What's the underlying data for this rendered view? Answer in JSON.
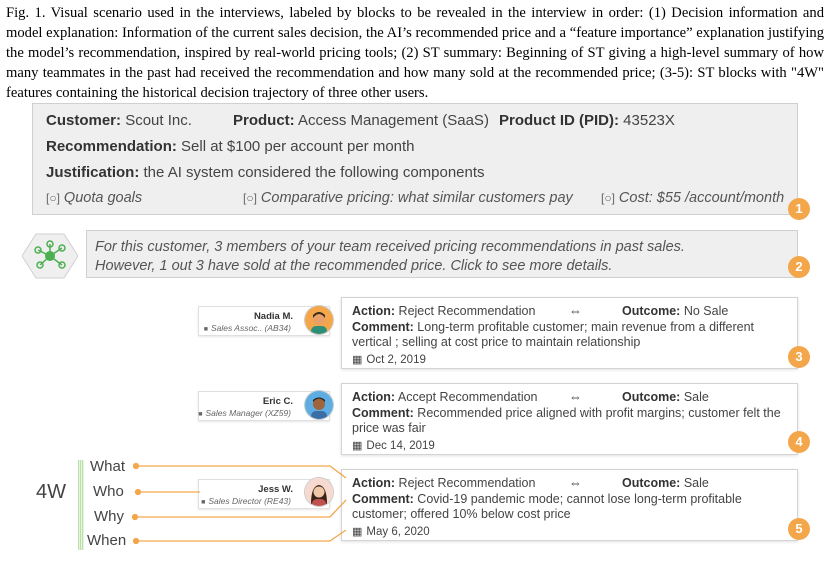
{
  "caption": "Fig. 1.  Visual scenario used in the interviews, labeled by blocks to be revealed in the interview in order: (1) Decision information and model explanation: Information of the current sales decision, the AI’s recommended price and a “feature importance” explanation justifying the model’s recommendation, inspired by real-world pricing tools; (2) ST summary: Beginning of ST giving a high-level summary of how many teammates in the past had received the recommendation and how many sold at the recommended price; (3-5): ST blocks with \"4W\" features containing the historical decision trajectory of three other users.",
  "decision": {
    "customer_label": "Customer:",
    "customer": "Scout Inc.",
    "product_label": "Product:",
    "product": "Access Management (SaaS)",
    "pid_label": "Product ID (PID):",
    "pid": "43523X",
    "recommendation_label": "Recommendation:",
    "recommendation": "Sell at $100 per account per month",
    "justification_label": "Justification:",
    "justification": "the AI system considered the following components",
    "components": [
      "Quota goals",
      "Comparative pricing: what similar customers pay",
      "Cost: $55 /account/month"
    ],
    "badge": "1"
  },
  "summary": {
    "line1": "For this customer, 3 members of your team received pricing recommendations in past sales.",
    "line2": "However, 1 out 3 have sold at the recommended price. Click to see more details.",
    "badge": "2"
  },
  "st_blocks": [
    {
      "name": "Nadia M.",
      "role": "Sales Assoc.. (AB34)",
      "action_label": "Action:",
      "action": "Reject Recommendation",
      "arrow": "⇔",
      "outcome_label": "Outcome:",
      "outcome": "No Sale",
      "comment_label": "Comment:",
      "comment": "Long-term profitable customer; main revenue from a different vertical ; selling at cost price to maintain relationship",
      "date": "Oct 2, 2019",
      "badge": "3",
      "skin": "#e8a06b",
      "hair": "#3a2a1a",
      "shirt": "#2b8f7a"
    },
    {
      "name": "Eric C.",
      "role": "Sales Manager (XZ59)",
      "action_label": "Action:",
      "action": "Accept Recommendation",
      "arrow": "⇔",
      "outcome_label": "Outcome:",
      "outcome": "Sale",
      "comment_label": "Comment:",
      "comment": "Recommended price aligned with profit margins; customer felt the price was fair",
      "date": "Dec 14, 2019",
      "badge": "4",
      "skin": "#a0643c",
      "hair": "#1e1e1e",
      "shirt": "#3a6ea5"
    },
    {
      "name": "Jess W.",
      "role": "Sales Director (RE43)",
      "action_label": "Action:",
      "action": "Reject Recommendation",
      "arrow": "⇔",
      "outcome_label": "Outcome:",
      "outcome": "Sale",
      "comment_label": "Comment:",
      "comment": "Covid-19 pandemic mode; cannot lose long-term profitable customer; offered 10% below cost price",
      "date": "May 6, 2020",
      "badge": "5",
      "skin": "#f0c8a8",
      "hair": "#3a2418",
      "shirt": "#c0504d"
    }
  ],
  "four_w": {
    "title": "4W",
    "labels": [
      "What",
      "Who",
      "Why",
      "When"
    ]
  },
  "colors": {
    "accent_orange": "#f4a64b",
    "connector": "#f4a64b",
    "green_icon": "#4caf50"
  },
  "icons": {
    "component": "component-bracket-icon",
    "calendar": "calendar-icon",
    "briefcase": "briefcase-icon",
    "network": "network-hex-icon"
  }
}
